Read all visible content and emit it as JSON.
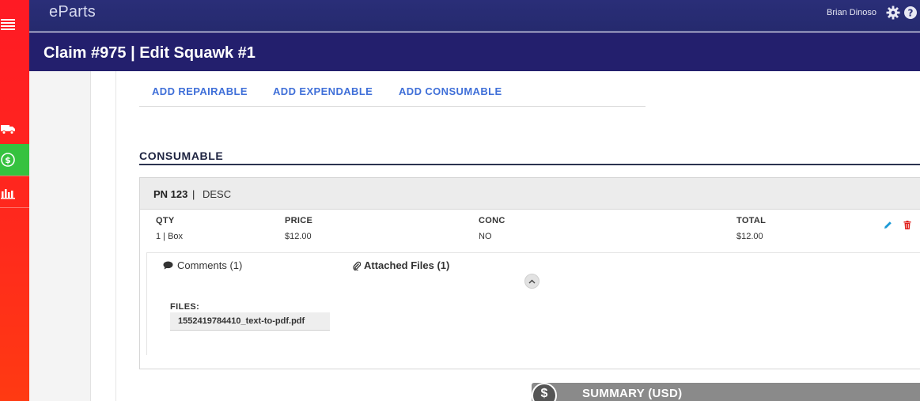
{
  "app": {
    "logo": "eParts",
    "user_name": "Brian Dinoso"
  },
  "page": {
    "title": "Claim #975 | Edit Squawk #1"
  },
  "add_links": [
    "ADD REPAIRABLE",
    "ADD EXPENDABLE",
    "ADD CONSUMABLE"
  ],
  "section": {
    "heading": "CONSUMABLE"
  },
  "item": {
    "pn": "PN 123",
    "separator": "|",
    "description": "DESC",
    "columns": {
      "qty_label": "QTY",
      "qty_value": "1 | Box",
      "price_label": "PRICE",
      "price_value": "$12.00",
      "conc_label": "CONC",
      "conc_value": "NO",
      "total_label": "TOTAL",
      "total_value": "$12.00"
    },
    "tabs": {
      "comments": "Comments (1)",
      "attached_files": "Attached Files (1)"
    },
    "files_label": "FILES:",
    "files": [
      "1552419784410_text-to-pdf.pdf"
    ]
  },
  "summary": {
    "symbol": "$",
    "label": "SUMMARY (USD)"
  },
  "icons": {
    "sidebar": [
      "menu-icon",
      "truck-icon",
      "dollar-cycle-icon",
      "bar-chart-icon"
    ],
    "header": [
      "gear-icon",
      "help-icon"
    ],
    "row_actions": [
      "pencil-icon",
      "trash-icon"
    ]
  },
  "colors": {
    "sidebar": "#ff1a24",
    "sidebar_active": "#35c23f",
    "topbar": "#2a2e78",
    "titlebar": "#231f6d",
    "link": "#3f6fd8",
    "edit": "#1b9ad6",
    "delete": "#e0201c"
  }
}
